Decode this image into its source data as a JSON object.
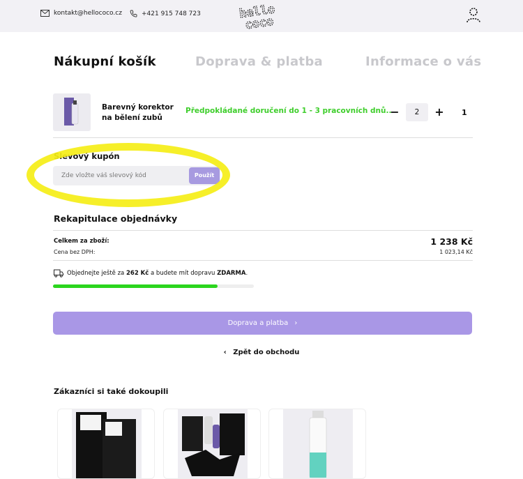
{
  "header": {
    "email": "kontakt@hellococo.cz",
    "phone": "+421 915 748 723",
    "logo_line1": "hello",
    "logo_line2": "coco"
  },
  "steps": [
    {
      "label": "Nákupní košík",
      "active": true
    },
    {
      "label": "Doprava & platba",
      "active": false
    },
    {
      "label": "Informace o vás",
      "active": false
    }
  ],
  "cart_item": {
    "name": "Barevný korektor na bělení zubů",
    "delivery": "Předpokládané doručení do 1 - 3 pracovních dnů..",
    "quantity": "2",
    "total_count": "1",
    "minus": "−",
    "plus": "+"
  },
  "coupon": {
    "title": "Slevový kupón",
    "placeholder": "Zde vložte váš slevový kód",
    "button": "Použít"
  },
  "summary": {
    "title": "Rekapitulace objednávky",
    "total_label": "Celkem za zboží:",
    "total_value": "1 238 Kč",
    "no_vat_label": "Cena bez DPH:",
    "no_vat_value": "1 023,14 Kč",
    "free_shipping_prefix": "Objednejte ještě za",
    "free_shipping_amount": "262 Kč",
    "free_shipping_middle": "a budete mít dopravu",
    "free_shipping_word": "ZDARMA",
    "free_shipping_suffix": ".",
    "progress": 0.82
  },
  "actions": {
    "continue": "Doprava a platba",
    "back": "Zpět do obchodu"
  },
  "upsell": {
    "title": "Zákazníci si také dokoupili"
  },
  "colors": {
    "accent": "#a997e6",
    "delivery_green": "#3fce2c",
    "progress_green": "#2bd51e",
    "highlight": "#f5ee17"
  }
}
